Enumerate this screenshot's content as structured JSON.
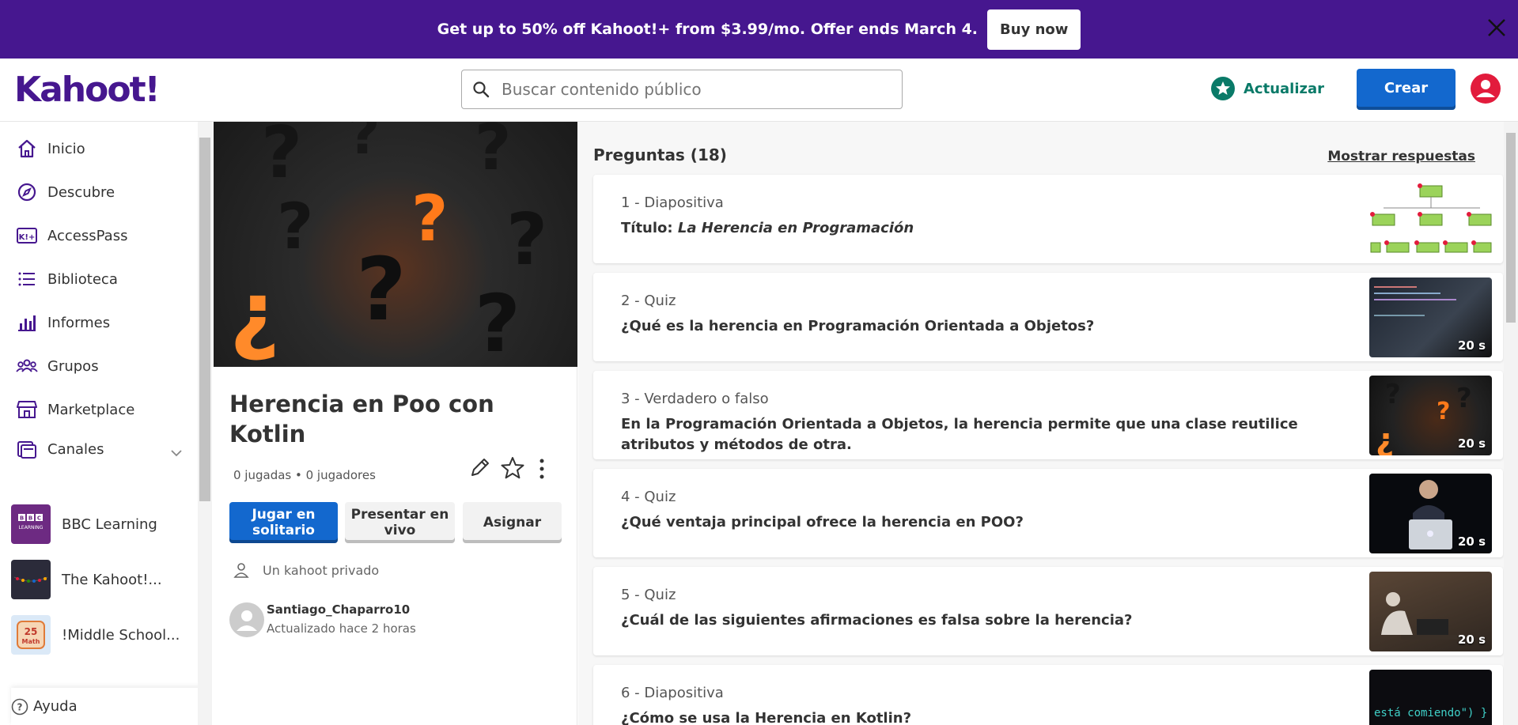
{
  "promo": {
    "text": "Get up to 50% off Kahoot!+ from $3.99/mo. Offer ends March 4.",
    "button": "Buy now"
  },
  "header": {
    "logo": "Kahoot!",
    "search_placeholder": "Buscar contenido público",
    "upgrade_label": "Actualizar",
    "create_label": "Crear"
  },
  "sidebar": {
    "items": [
      {
        "label": "Inicio",
        "icon": "home-icon"
      },
      {
        "label": "Descubre",
        "icon": "compass-icon"
      },
      {
        "label": "AccessPass",
        "icon": "accesspass-icon"
      },
      {
        "label": "Biblioteca",
        "icon": "list-icon"
      },
      {
        "label": "Informes",
        "icon": "bar-chart-icon"
      },
      {
        "label": "Grupos",
        "icon": "users-icon"
      },
      {
        "label": "Marketplace",
        "icon": "store-icon"
      },
      {
        "label": "Canales",
        "icon": "channels-icon"
      }
    ],
    "channels": [
      {
        "label": "BBC Learning",
        "thumb_text": "BBC LEARNING"
      },
      {
        "label": "The Kahoot!..."
      },
      {
        "label": "!Middle School...",
        "thumb_text": "25 Math"
      }
    ],
    "help_label": "Ayuda"
  },
  "detail": {
    "title": "Herencia en Poo con Kotlin",
    "stats": "0 jugadas • 0 jugadores",
    "buttons": {
      "solo": "Jugar en solitario",
      "live": "Presentar en vivo",
      "assign": "Asignar"
    },
    "privacy": "Un kahoot privado",
    "author": "Santiago_Chaparro10",
    "updated": "Actualizado hace 2 horas"
  },
  "questions": {
    "heading": "Preguntas (18)",
    "show_answers": "Mostrar respuestas",
    "items": [
      {
        "type": "1 - Diapositiva",
        "prefix": "Título: ",
        "text": "La Herencia en Programación",
        "time": ""
      },
      {
        "type": "2 - Quiz",
        "prefix": "",
        "text": "¿Qué es la herencia en Programación Orientada a Objetos?",
        "time": "20 s"
      },
      {
        "type": "3 - Verdadero o falso",
        "prefix": "",
        "text": "En la Programación Orientada a Objetos, la herencia permite que una clase reutilice atributos y métodos de otra.",
        "time": "20 s"
      },
      {
        "type": "4 - Quiz",
        "prefix": "",
        "text": "¿Qué ventaja principal ofrece la herencia en POO?",
        "time": "20 s"
      },
      {
        "type": "5 - Quiz",
        "prefix": "",
        "text": "¿Cuál de las siguientes afirmaciones es falsa sobre la herencia?",
        "time": "20 s"
      },
      {
        "type": "6 - Diapositiva",
        "prefix": "",
        "text": "¿Cómo se usa la Herencia en Kotlin?",
        "time": "",
        "thumb_text": "está comiendo\") }"
      }
    ]
  },
  "colors": {
    "brand_purple": "#46178f",
    "primary_blue": "#1368ce",
    "upgrade_teal": "#0a7a68",
    "avatar_red": "#e21b3c"
  }
}
